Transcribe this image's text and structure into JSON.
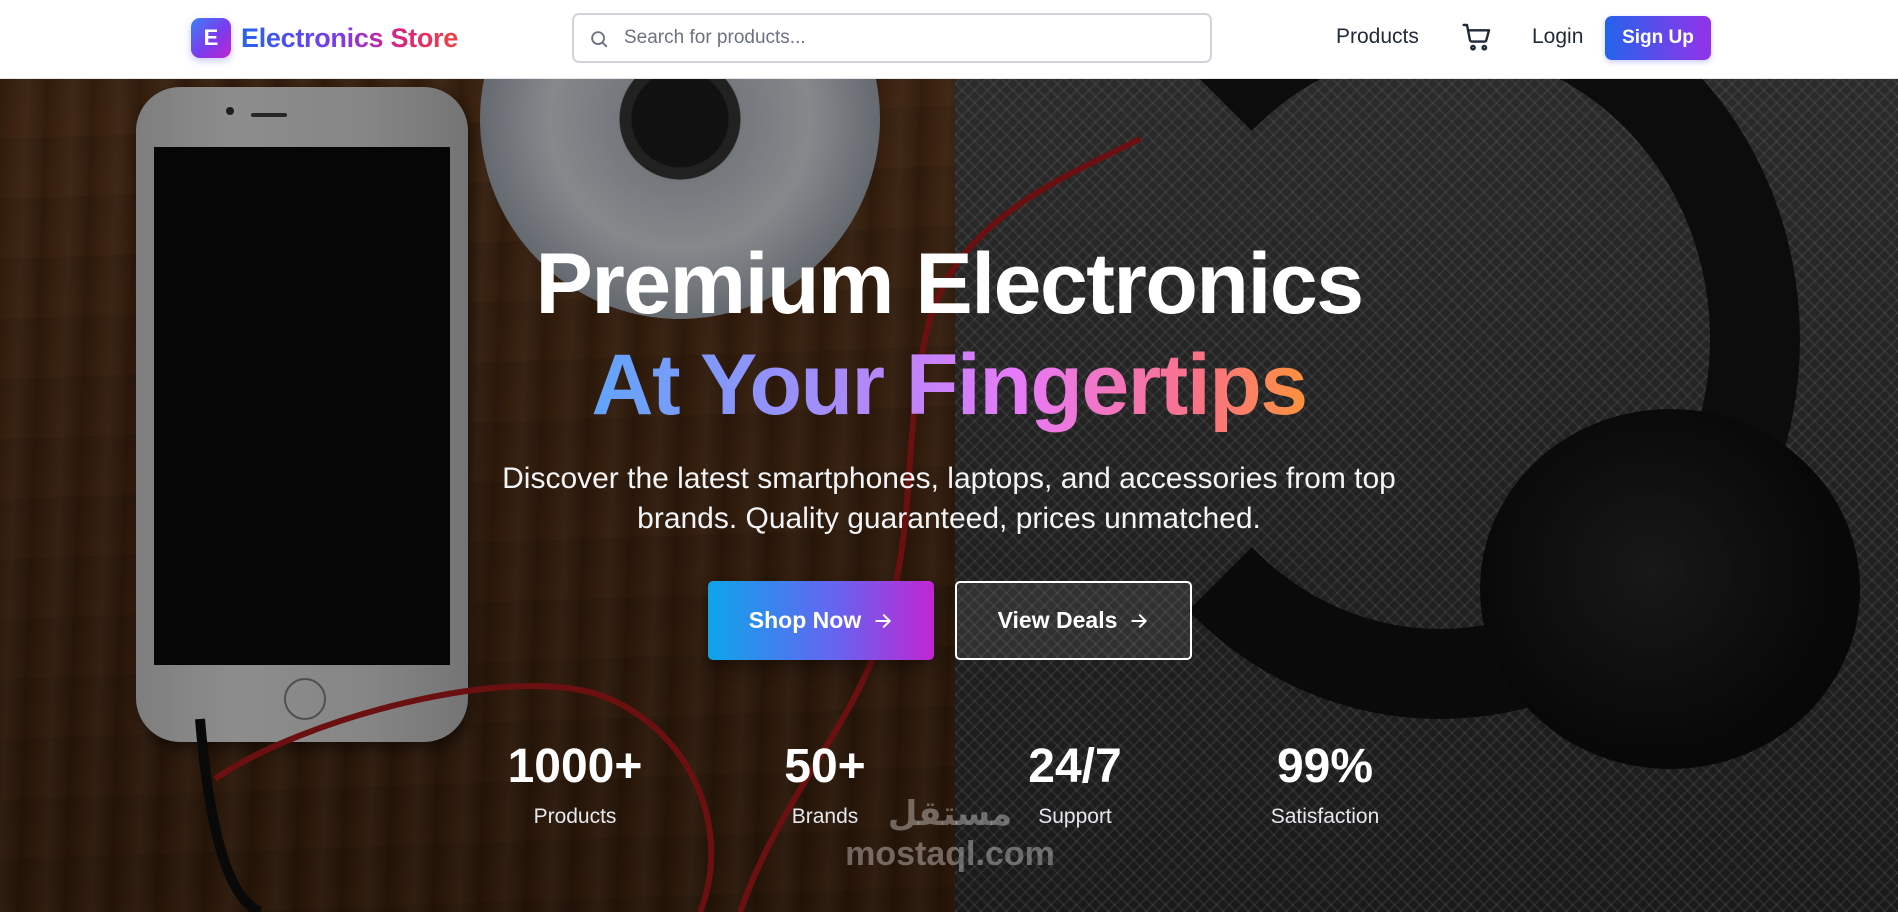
{
  "brand": {
    "logo_letter": "E",
    "name": "Electronics Store"
  },
  "search": {
    "placeholder": "Search for products...",
    "value": "",
    "icon": "search-icon"
  },
  "nav": {
    "products_label": "Products",
    "cart_icon": "shopping-cart-icon",
    "login_label": "Login",
    "signup_label": "Sign Up"
  },
  "hero": {
    "title_line1": "Premium Electronics",
    "title_line2": "At Your Fingertips",
    "description": "Discover the latest smartphones, laptops, and accessories from top brands. Quality guaranteed, prices unmatched.",
    "shop_button": "Shop Now",
    "deals_button": "View Deals",
    "button_icon": "arrow-right-icon"
  },
  "stats": [
    {
      "value": "1000+",
      "label": "Products"
    },
    {
      "value": "50+",
      "label": "Brands"
    },
    {
      "value": "24/7",
      "label": "Support"
    },
    {
      "value": "99%",
      "label": "Satisfaction"
    }
  ],
  "watermark": {
    "arabic": "مستقل",
    "latin": "mostaql.com"
  },
  "colors": {
    "brand_gradient_start": "#2563eb",
    "brand_gradient_mid": "#9333ea",
    "brand_gradient_end": "#ef4444",
    "nav_text": "#1f2937",
    "hero_text": "#ffffff"
  }
}
